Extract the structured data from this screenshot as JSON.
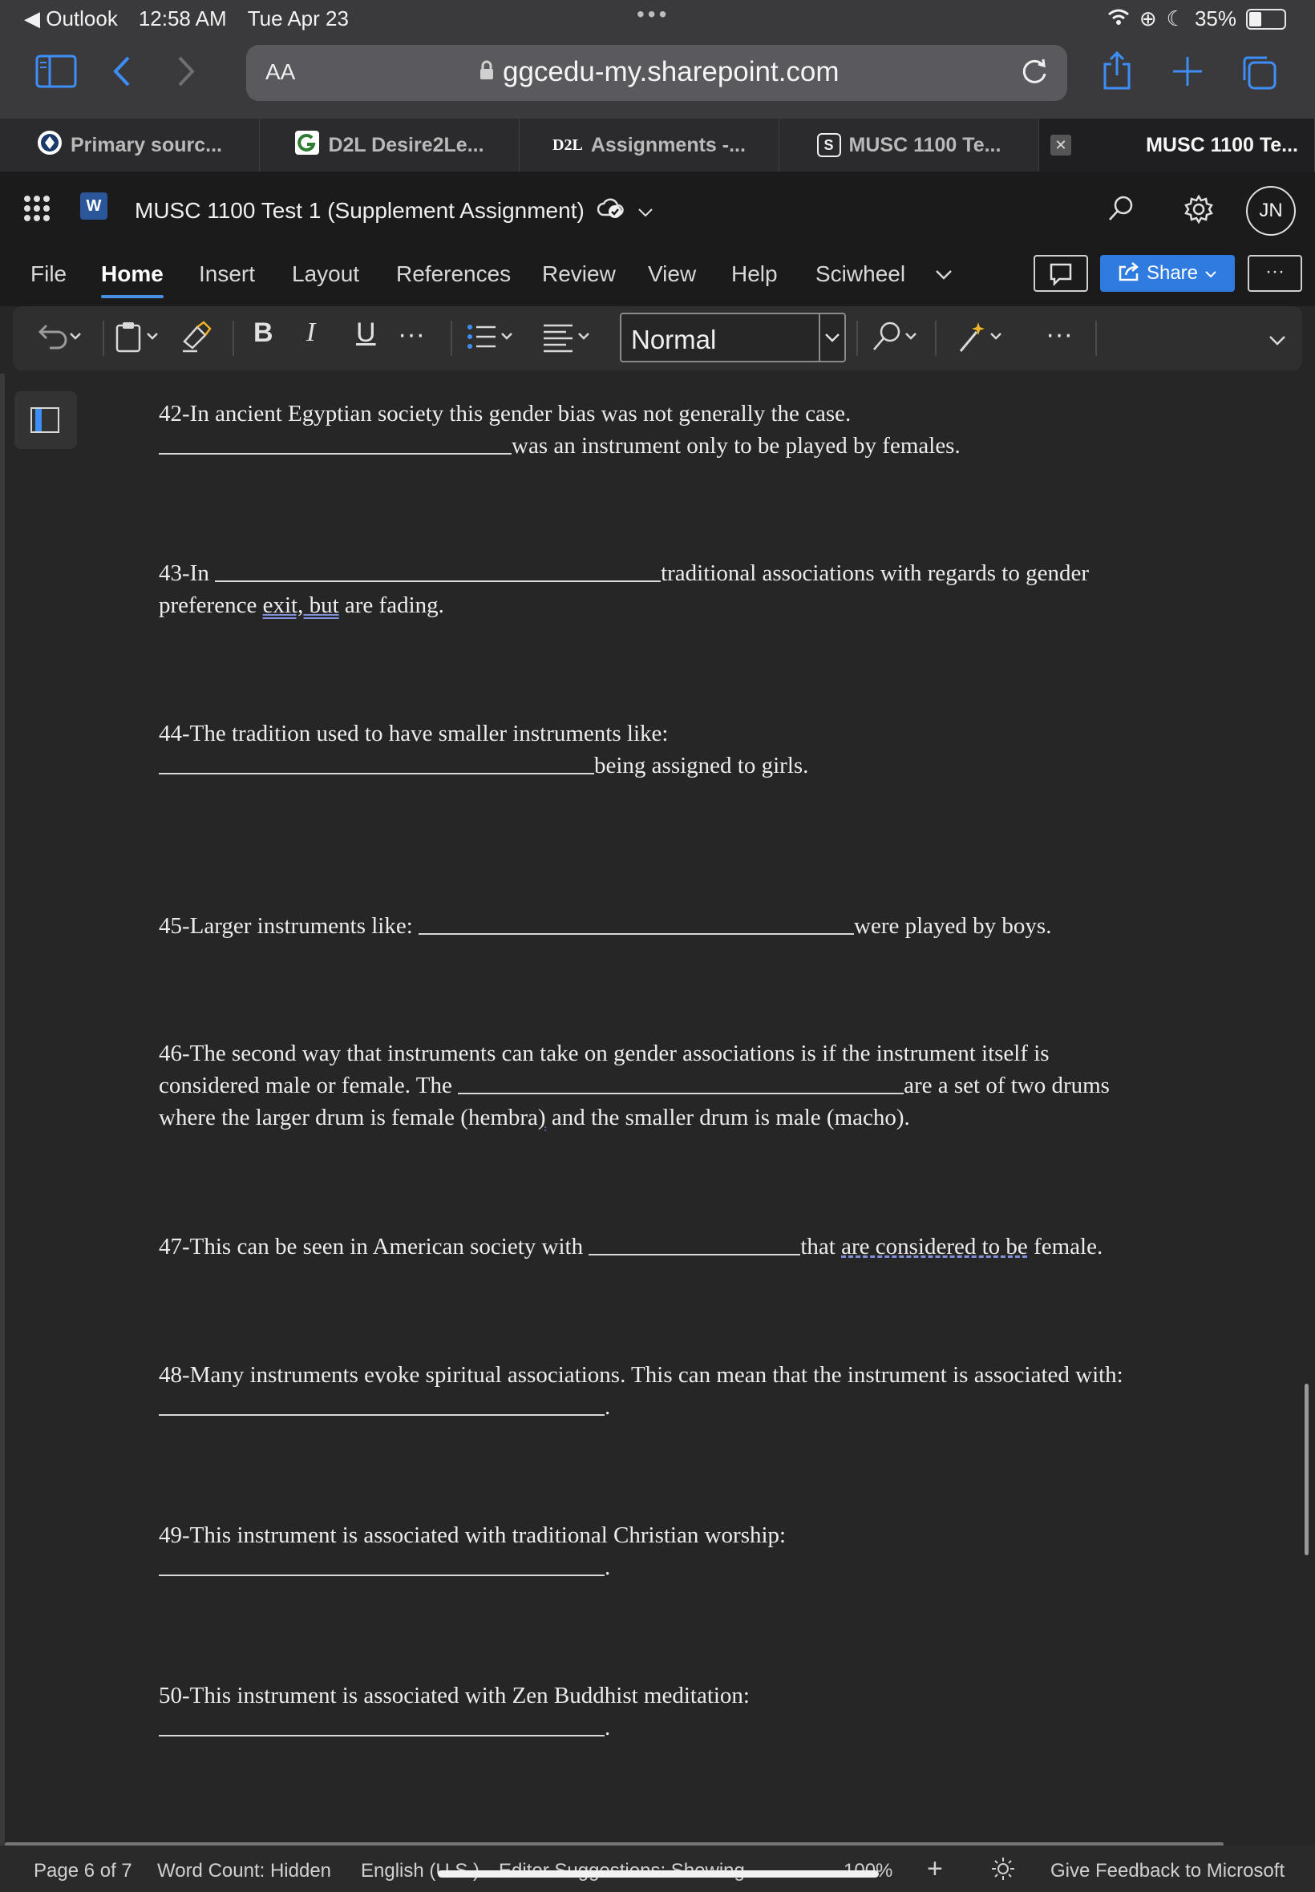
{
  "status_bar": {
    "back_app": "Outlook",
    "time": "12:58 AM",
    "date": "Tue Apr 23",
    "battery": "35%",
    "battery_level": 0.35
  },
  "safari": {
    "text_size_label": "AA",
    "url": "ggcedu-my.sharepoint.com",
    "tabs": [
      {
        "label": "Primary sourc...",
        "icon": "primary-source-icon"
      },
      {
        "label": "D2L Desire2Le...",
        "icon": "d2l-icon"
      },
      {
        "label": "Assignments -...",
        "icon": "d2l-logo-icon",
        "badge": "D2L"
      },
      {
        "label": "MUSC 1100 Te...",
        "icon": "sharepoint-icon",
        "badge": "S"
      },
      {
        "label": "MUSC 1100 Te...",
        "icon": "close-icon",
        "active": true
      }
    ]
  },
  "word": {
    "app_badge": "W",
    "doc_title": "MUSC 1100 Test 1 (Supplement Assignment)",
    "avatar": "JN",
    "ribbon_tabs": [
      "File",
      "Home",
      "Insert",
      "Layout",
      "References",
      "Review",
      "View",
      "Help",
      "Sciwheel"
    ],
    "share_label": "Share",
    "style_value": "Normal",
    "bold": "B",
    "italic": "I",
    "underline": "U",
    "more": "···"
  },
  "document": {
    "q42": {
      "line1": "42-In ancient Egyptian society this gender bias was not generally the case.",
      "line2": "was an instrument only to be played by females."
    },
    "q43": {
      "pre": "43-In",
      "post": "traditional associations with regards to gender",
      "line2_pre": "preference",
      "line2_flag": "exit, but",
      "line2_post": "are fading."
    },
    "q44": {
      "line1": "44-The tradition used to have smaller instruments like:",
      "line2": "being assigned to girls."
    },
    "q45": {
      "pre": "45-Larger instruments like:",
      "post": "were played by boys."
    },
    "q46": {
      "line1": "46-The second way that instruments can take on gender associations is if the instrument itself is",
      "line2_pre": "considered male or female. The",
      "line2_post": "are a set of two drums",
      "line3_pre": "where the larger drum is female (hembra",
      "line3_flag": ")",
      "line3_post": "and the smaller drum is male (macho)."
    },
    "q47": {
      "pre": "47-This can be seen in American society with",
      "post_a": "that",
      "post_flag": "are considered to be",
      "post_b": "female."
    },
    "q48": {
      "line1": "48-Many instruments evoke spiritual associations. This can mean that the instrument is associated with:",
      "end": "."
    },
    "q49": {
      "line1": "49-This instrument is associated with traditional Christian worship:",
      "end": "."
    },
    "q50": {
      "line1": "50-This instrument is associated with Zen Buddhist meditation:",
      "end": "."
    }
  },
  "footer": {
    "page": "Page 6 of 7",
    "word_count": "Word Count: Hidden",
    "language": "English (U.S.)",
    "editor": "Editor Suggestions: Showing",
    "zoom": "100%",
    "zoom_in": "+",
    "feedback": "Give Feedback to Microsoft"
  },
  "colors": {
    "accent": "#2f7be0",
    "link_blue": "#3d8ef7",
    "doc_bg": "#262626",
    "word_badge": "#2b579a"
  }
}
